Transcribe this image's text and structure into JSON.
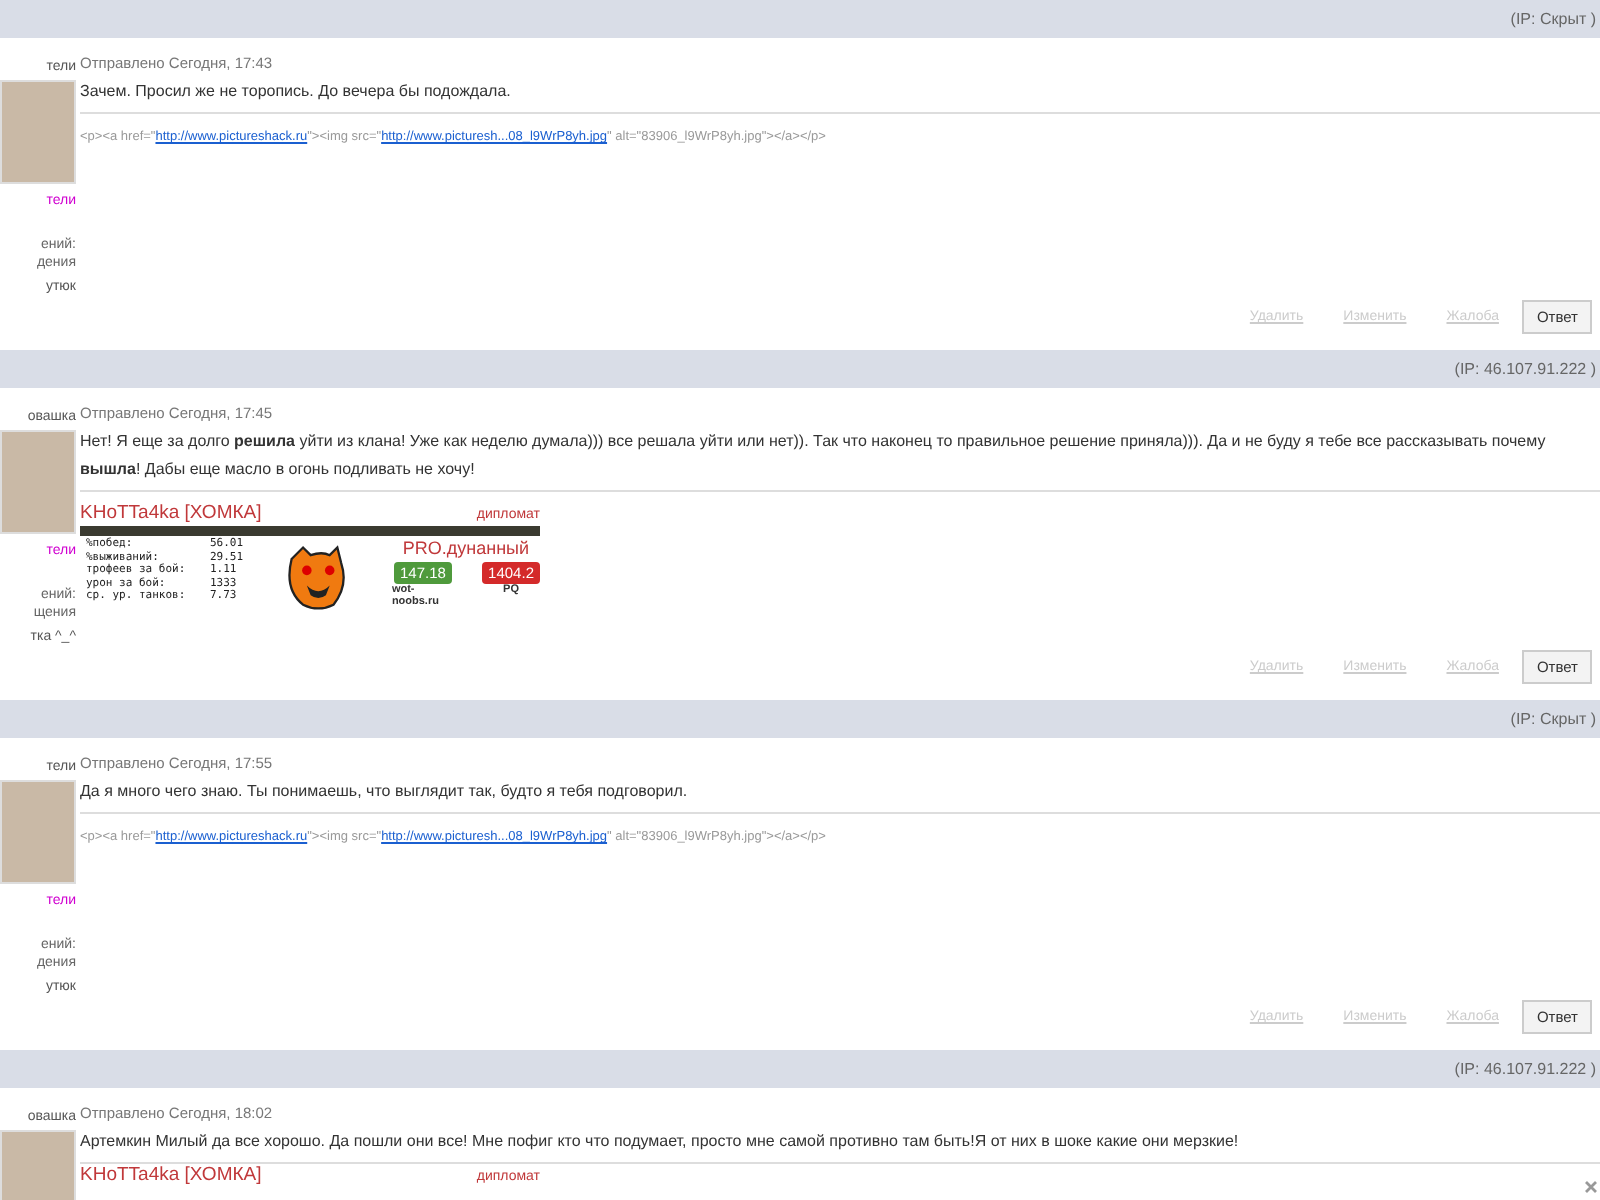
{
  "posts": [
    {
      "ip": "(IP: Скрыт )",
      "author": {
        "name": "тели",
        "group": "тели",
        "info": [
          "ений:",
          "дения"
        ],
        "extra": "утюк"
      },
      "date": "Отправлено Сегодня, 17:43",
      "message": "Зачем. Просил же не торопись. До вечера бы подождала.",
      "signature": {
        "kind": "code",
        "parts": [
          {
            "kind": "text",
            "text": "<p><a href=\""
          },
          {
            "kind": "link",
            "text": "http://www.pictureshack.ru"
          },
          {
            "kind": "text",
            "text": "\"><img src=\""
          },
          {
            "kind": "link",
            "text": "http://www.picturesh...08_l9WrP8yh.jpg"
          },
          {
            "kind": "text",
            "text": "\" alt=\"83906_l9WrP8yh.jpg\"></a></p>"
          }
        ]
      },
      "buttons": [
        {
          "label": "Удалить",
          "kind": "link",
          "disabled": true
        },
        {
          "label": "Изменить",
          "kind": "link",
          "disabled": true
        },
        {
          "label": "Жалоба",
          "kind": "link",
          "disabled": true
        },
        {
          "label": "Ответ",
          "kind": "button",
          "disabled": false
        }
      ],
      "closable": false
    },
    {
      "ip": "(IP: 46.107.91.222 )",
      "author": {
        "name": "овашка",
        "group": "тели",
        "info": [
          "ений:",
          "щения"
        ],
        "extra": "тка ^_^"
      },
      "date": "Отправлено Сегодня, 17:45",
      "message": "Нет! Я еще за долго **решила** уйти из клана! Уже как неделю думала))) все решала уйти или нет)). Так что наконец то правильное решение приняла))). Да и не буду я тебе все рассказывать почему **вышла**! Дабы еще масло в огонь подливать не хочу!",
      "signature": {
        "kind": "userbar",
        "title": "KHoTTa4ka [ХОМКА]",
        "rank": "дипломат",
        "stats": [
          {
            "label": "%побед:",
            "value": "56.01"
          },
          {
            "label": "%выживаний:",
            "value": "29.51"
          },
          {
            "label": "трофеев за бой:",
            "value": "1.11"
          },
          {
            "label": "урон за бой:",
            "value": "1333"
          },
          {
            "label": "ср. ур. танков:",
            "value": "7.73"
          }
        ],
        "rating_title": "PRO.дунанный",
        "ratings": [
          {
            "value": "147.18",
            "caption": "wot-noobs.ru",
            "color": "#4f9a3c"
          },
          {
            "value": "1404.2",
            "caption": "PQ",
            "color": "#d42a2a"
          }
        ]
      },
      "buttons": [
        {
          "label": "Удалить",
          "kind": "link",
          "disabled": true
        },
        {
          "label": "Изменить",
          "kind": "link",
          "disabled": true
        },
        {
          "label": "Жалоба",
          "kind": "link",
          "disabled": true
        },
        {
          "label": "Ответ",
          "kind": "button",
          "disabled": false
        }
      ],
      "closable": false
    },
    {
      "ip": "(IP: Скрыт )",
      "author": {
        "name": "тели",
        "group": "тели",
        "info": [
          "ений:",
          "дения"
        ],
        "extra": "утюк"
      },
      "date": "Отправлено Сегодня, 17:55",
      "message": "Да я много чего знаю. Ты понимаешь, что выглядит так, будто я тебя подговорил.",
      "signature": {
        "kind": "code",
        "parts": [
          {
            "kind": "text",
            "text": "<p><a href=\""
          },
          {
            "kind": "link",
            "text": "http://www.pictureshack.ru"
          },
          {
            "kind": "text",
            "text": "\"><img src=\""
          },
          {
            "kind": "link",
            "text": "http://www.picturesh...08_l9WrP8yh.jpg"
          },
          {
            "kind": "text",
            "text": "\" alt=\"83906_l9WrP8yh.jpg\"></a></p>"
          }
        ]
      },
      "buttons": [
        {
          "label": "Удалить",
          "kind": "link",
          "disabled": true
        },
        {
          "label": "Изменить",
          "kind": "link",
          "disabled": true
        },
        {
          "label": "Жалоба",
          "kind": "link",
          "disabled": true
        },
        {
          "label": "Ответ",
          "kind": "button",
          "disabled": false
        }
      ],
      "closable": false
    },
    {
      "ip": "(IP: 46.107.91.222 )",
      "author": {
        "name": "овашка"
      },
      "date": "Отправлено Сегодня, 18:02",
      "message": "Артемкин Милый да все хорошо. Да пошли они все! Мне пофиг кто что подумает, просто мне самой противно там быть!Я от них в шоке какие они мерзкие!",
      "signature": {
        "kind": "userbar",
        "title": "KHoTTa4ka [ХОМКА]",
        "rank": "дипломат"
      },
      "closable": true
    }
  ]
}
